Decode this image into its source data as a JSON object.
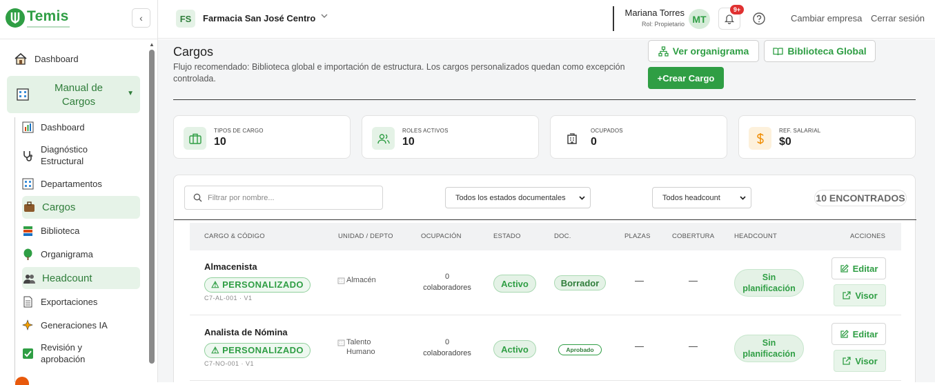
{
  "app": {
    "brand": "Temis"
  },
  "sidebar": {
    "dashboard": "Dashboard",
    "manual": "Manual de Cargos",
    "items": [
      {
        "label": "Dashboard",
        "icon": "bar-chart-icon"
      },
      {
        "label": "Diagnóstico Estructural",
        "icon": "stethoscope-icon"
      },
      {
        "label": "Departamentos",
        "icon": "building-icon"
      },
      {
        "label": "Cargos",
        "icon": "briefcase-icon"
      },
      {
        "label": "Biblioteca",
        "icon": "books-icon"
      },
      {
        "label": "Organigrama",
        "icon": "tree-icon"
      },
      {
        "label": "Headcount",
        "icon": "people-icon"
      },
      {
        "label": "Exportaciones",
        "icon": "document-icon"
      },
      {
        "label": "Generaciones IA",
        "icon": "sparkles-icon"
      },
      {
        "label": "Revisión y aprobación",
        "icon": "checkbox-icon"
      }
    ]
  },
  "topbar": {
    "company_initials": "FS",
    "company_name": "Farmacia San José Centro",
    "user_name": "Mariana Torres",
    "user_role": "Rol: Propietario",
    "avatar_initials": "MT",
    "notifications": "9+",
    "switch_company": "Cambiar empresa",
    "logout": "Cerrar sesión"
  },
  "page": {
    "title": "Cargos",
    "description": "Flujo recomendado: Biblioteca global e importación de estructura. Los cargos personalizados quedan como excepción controlada.",
    "btn_org": "Ver organigrama",
    "btn_library": "Biblioteca Global",
    "btn_create": "+Crear Cargo"
  },
  "stats": [
    {
      "label": "TIPOS DE CARGO",
      "value": "10"
    },
    {
      "label": "ROLES ACTIVOS",
      "value": "10"
    },
    {
      "label": "OCUPADOS",
      "value": "0"
    },
    {
      "label": "REF. SALARIAL",
      "value": "$0"
    }
  ],
  "filters": {
    "search_placeholder": "Filtrar por nombre...",
    "doc_status": "Todos los estados documentales",
    "headcount": "Todos headcount",
    "found": "10 ENCONTRADOS"
  },
  "table": {
    "headers": [
      "CARGO & CÓDIGO",
      "UNIDAD / DEPTO",
      "OCUPACIÓN",
      "ESTADO",
      "DOC.",
      "PLAZAS",
      "COBERTURA",
      "HEADCOUNT",
      "ACCIONES"
    ],
    "rows": [
      {
        "name": "Almacenista",
        "badge": "⚠ PERSONALIZADO",
        "code": "C7-AL-001 · V1",
        "unit": "Almacén",
        "occ_num": "0",
        "occ_label": "colaboradores",
        "status": "Activo",
        "doc": "Borrador",
        "plazas": "—",
        "cobertura": "—",
        "headcount": "Sin planificación",
        "edit": "Editar",
        "view": "Visor"
      },
      {
        "name": "Analista de Nómina",
        "badge": "⚠ PERSONALIZADO",
        "code": "C7-NO-001 · V1",
        "unit": "Talento Humano",
        "occ_num": "0",
        "occ_label": "colaboradores",
        "status": "Activo",
        "doc": "Aprobado",
        "plazas": "—",
        "cobertura": "—",
        "headcount": "Sin planificación",
        "edit": "Editar",
        "view": "Visor"
      }
    ]
  },
  "colors": {
    "accent": "#2f9e44",
    "accent_light": "#e4f2e6",
    "badge_red": "#e03131"
  }
}
